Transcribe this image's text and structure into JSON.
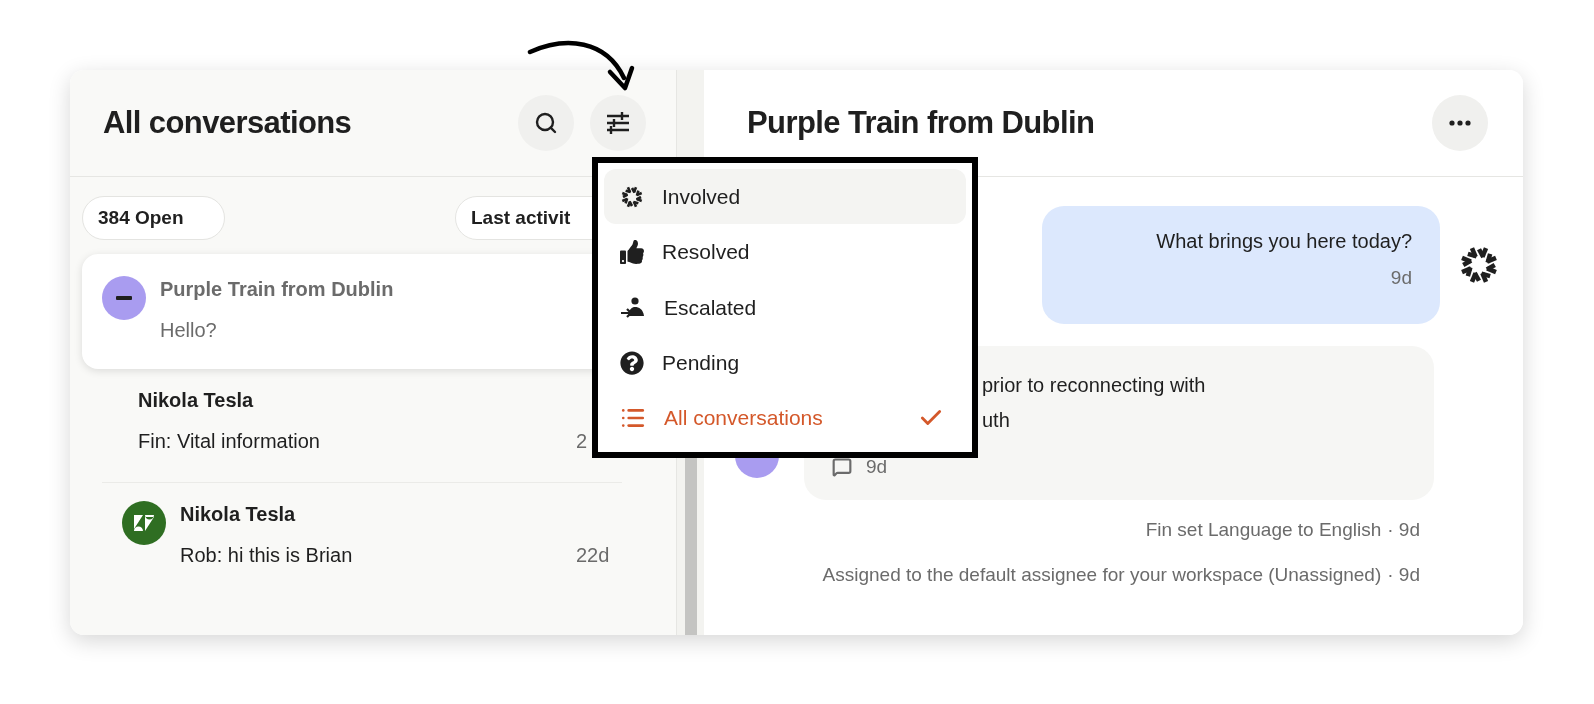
{
  "conversation_list": {
    "title": "All conversations",
    "open_count": "384 Open",
    "sort": "Last activit",
    "conversations": [
      {
        "name": "Purple Train from Dublin",
        "preview": "Hello?",
        "selected": true,
        "avatar": {
          "kind": "anonymous",
          "color": "#a99cf0"
        }
      },
      {
        "name": "Nikola Tesla",
        "preview": "Fin: Vital information",
        "time": "2",
        "selected": false
      },
      {
        "name": "Nikola Tesla",
        "preview": "Rob: hi this is Brian",
        "time": "22d",
        "selected": false,
        "avatar": {
          "kind": "zendesk",
          "color": "#2f6e22"
        }
      }
    ]
  },
  "filter_menu": {
    "items": [
      {
        "label": "Involved",
        "kind": "involved",
        "hovered": true,
        "selected": false
      },
      {
        "label": "Resolved",
        "kind": "resolved",
        "hovered": false,
        "selected": false
      },
      {
        "label": "Escalated",
        "kind": "escalated",
        "hovered": false,
        "selected": false
      },
      {
        "label": "Pending",
        "kind": "pending",
        "hovered": false,
        "selected": false
      },
      {
        "label": "All conversations",
        "kind": "all",
        "hovered": false,
        "selected": true
      }
    ]
  },
  "conversation": {
    "title": "Purple Train from Dublin",
    "messages": [
      {
        "kind": "outgoing",
        "lines": [
          "What brings you here today?"
        ],
        "time": "9d"
      },
      {
        "kind": "incoming",
        "lines": [
          "prior to reconnecting with",
          "uth"
        ],
        "time": "9d"
      }
    ],
    "events": [
      {
        "text": "Fin set Language to English",
        "time": "· 9d"
      },
      {
        "text": "Assigned to the default assignee for your workspace (Unassigned)",
        "time": "· 9d"
      }
    ]
  }
}
